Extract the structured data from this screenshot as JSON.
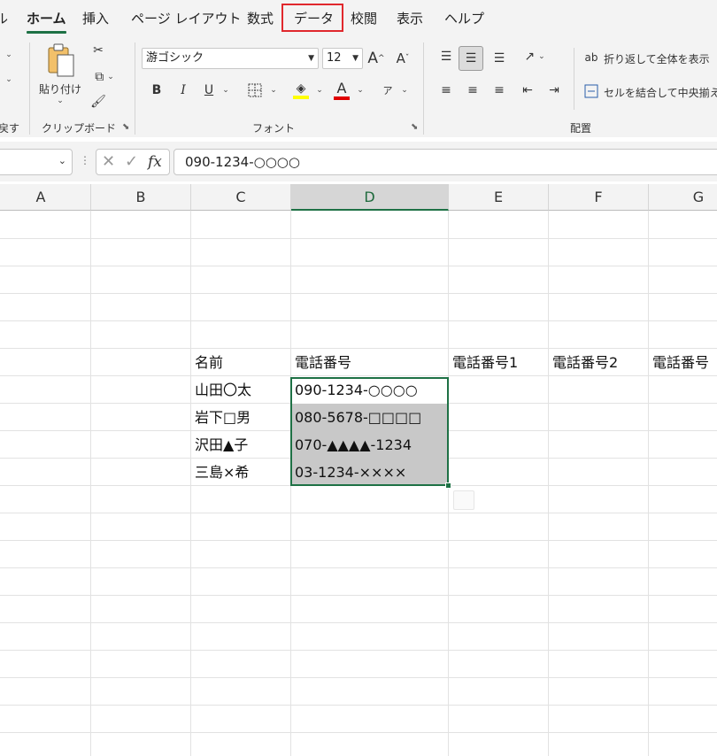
{
  "tabs": [
    {
      "label": "ル"
    },
    {
      "label": "ホーム"
    },
    {
      "label": "挿入"
    },
    {
      "label": "ページ レイアウト"
    },
    {
      "label": "数式"
    },
    {
      "label": "データ"
    },
    {
      "label": "校閲"
    },
    {
      "label": "表示"
    },
    {
      "label": "ヘルプ"
    }
  ],
  "ribbon": {
    "undo_label": "戻す",
    "clipboard_label": "クリップボード",
    "paste_label": "貼り付け",
    "font_group_label": "フォント",
    "alignment_group_label": "配置",
    "font_name": "游ゴシック",
    "font_size": "12",
    "bold": "B",
    "italic": "I",
    "underline": "U",
    "font_color": "A",
    "wrap_text": "折り返して全体を表示",
    "merge_center": "セルを結合して中央揃え",
    "highlight_color": "#ffff00",
    "font_color_value": "#e00000"
  },
  "formula_bar": {
    "fx": "fx",
    "value": "090-1234-○○○○"
  },
  "columns": [
    "A",
    "B",
    "C",
    "D",
    "E",
    "F",
    "G"
  ],
  "selected_column": "D",
  "table": {
    "headers": [
      "名前",
      "電話番号",
      "電話番号1",
      "電話番号2",
      "電話番号"
    ],
    "rows": [
      {
        "name": "山田〇太",
        "phone": "090-1234-○○○○"
      },
      {
        "name": "岩下□男",
        "phone": "080-5678-□□□□"
      },
      {
        "name": "沢田▲子",
        "phone": "070-▲▲▲▲-1234"
      },
      {
        "name": "三島×希",
        "phone": "03-1234-××××"
      }
    ]
  },
  "colors": {
    "accent": "#1e7145",
    "highlight_box": "#e0282d",
    "selection_fill": "#c8c8c8"
  }
}
